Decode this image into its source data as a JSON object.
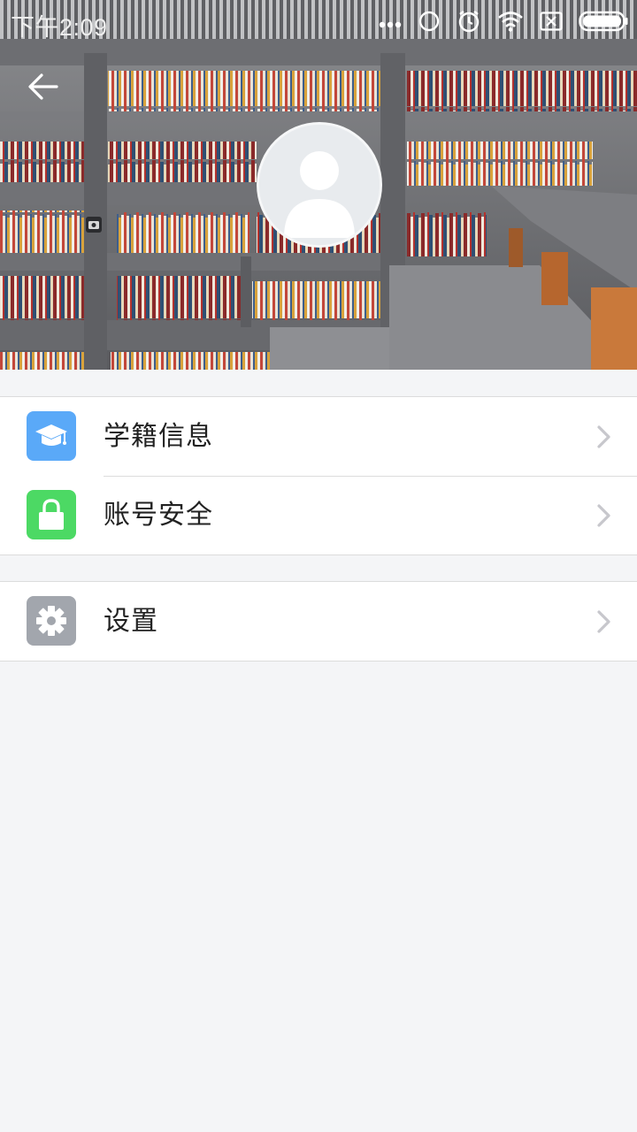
{
  "status_bar": {
    "time": "下午2:09",
    "icons": [
      "more-dots-icon",
      "sync-icon",
      "alarm-icon",
      "wifi-icon",
      "no-sim-icon",
      "battery-icon"
    ]
  },
  "header": {
    "back_icon": "back-arrow-icon",
    "avatar_icon": "default-avatar-icon",
    "background": "bookshelf-photo"
  },
  "menu": {
    "group1": [
      {
        "label": "学籍信息",
        "icon": "graduation-cap-icon",
        "icon_color": "#5aa9f8"
      },
      {
        "label": "账号安全",
        "icon": "lock-icon",
        "icon_color": "#4cd964"
      }
    ],
    "group2": [
      {
        "label": "设置",
        "icon": "gear-icon",
        "icon_color": "#a2a6ad"
      }
    ]
  },
  "colors": {
    "page_background": "#f4f5f7",
    "row_background": "#ffffff",
    "divider": "#dcdcdc",
    "chevron": "#c7c7cc"
  }
}
